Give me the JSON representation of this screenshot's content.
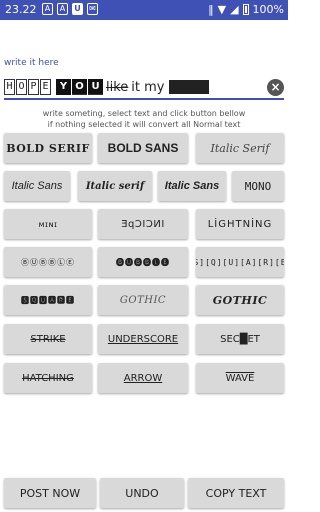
{
  "status": {
    "time": "23.22",
    "icons": [
      "A",
      "A",
      "U",
      "✉"
    ],
    "battery": "100%"
  },
  "editor": {
    "hint": "write it here",
    "boxed_chars": [
      "H",
      "O",
      "P",
      "E"
    ],
    "neg_chars": [
      "Y",
      "O",
      "U"
    ],
    "strike_text": "like",
    "plain_text": "it my",
    "clear_icon": "×"
  },
  "info": {
    "line1": "write someting, select text and click button bellow",
    "line2": "if nothing selected it will convert all Normal text"
  },
  "styles": [
    {
      "key": "bold-serif",
      "label": "BOLD SERIF",
      "cls": "f-boldserif"
    },
    {
      "key": "bold-sans",
      "label": "BOLD SANS",
      "cls": "f-boldsans"
    },
    {
      "key": "italic-serif",
      "label": "Italic Serif",
      "cls": "f-italicserif"
    },
    {
      "key": "italic-sans",
      "label": "Italic Sans",
      "cls": "f-italicsans"
    },
    {
      "key": "italic-serif-bold",
      "label": "Italic serif",
      "cls": "f-italicserifb"
    },
    {
      "key": "italic-sans-bold",
      "label": "Italic Sans",
      "cls": "f-italicsansb"
    },
    {
      "key": "mono",
      "label": "MONO",
      "cls": "f-mono"
    },
    {
      "key": "mini",
      "label": "ᴍɪɴɪ",
      "cls": "f-mini"
    },
    {
      "key": "mirror",
      "label": "ƎqƆIƆИI",
      "cls": "f-mirror"
    },
    {
      "key": "lightning",
      "label": "LİGHTNİNG",
      "cls": "f-lightning"
    },
    {
      "key": "bubble",
      "label": "ⒷⓊⒷⒷⓁⒺ",
      "cls": "f-bubble"
    },
    {
      "key": "bubble-fill",
      "label": "🅑🅤🅑🅑🅛🅔",
      "cls": "f-bubblefill"
    },
    {
      "key": "square",
      "label": "[S][Q][U][A][R][E]",
      "cls": "f-square"
    },
    {
      "key": "square-fill",
      "label": "🆂🆀🆄🅰🆁🅴",
      "cls": "f-squarefill"
    },
    {
      "key": "gothic",
      "label": "GOTHIC",
      "cls": "f-gothic"
    },
    {
      "key": "gothic-bold",
      "label": "GOTHIC",
      "cls": "f-gothicb"
    },
    {
      "key": "strike",
      "label": "STRIKE",
      "cls": "f-strike"
    },
    {
      "key": "underscore",
      "label": "UNDERSCORE",
      "cls": "f-underscore"
    },
    {
      "key": "secret",
      "label": "SEC█ET",
      "cls": "f-secret"
    },
    {
      "key": "hatching",
      "label": "HATCHING",
      "cls": "f-hatching"
    },
    {
      "key": "arrow",
      "label": "ARROW",
      "cls": "f-arrow"
    },
    {
      "key": "wave",
      "label": "WAVE",
      "cls": "f-wave"
    }
  ],
  "actions": {
    "post": "POST NOW",
    "undo": "UNDO",
    "copy": "COPY TEXT"
  },
  "colors": {
    "accent": "#3f51b5",
    "button_bg": "#d9d9d9"
  }
}
